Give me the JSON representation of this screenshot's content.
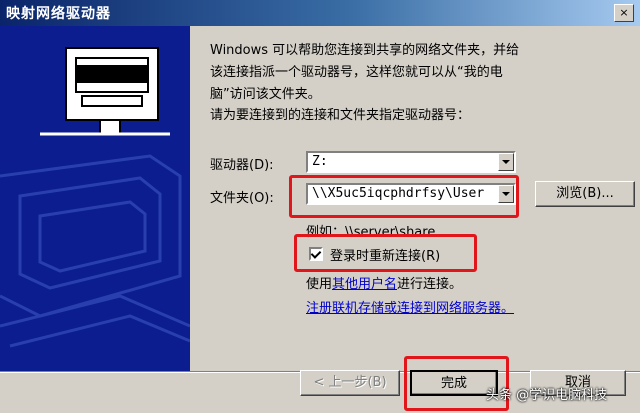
{
  "window": {
    "title": "映射网络驱动器",
    "close_glyph": "×"
  },
  "intro": {
    "line1": "Windows 可以帮助您连接到共享的网络文件夹，并给",
    "line2": "该连接指派一个驱动器号，这样您就可以从“我的电",
    "line3": "脑”访问该文件夹。"
  },
  "prompt": "请为要连接到的连接和文件夹指定驱动器号：",
  "drive": {
    "label": "驱动器(D):",
    "value": "Z:"
  },
  "folder": {
    "label": "文件夹(O):",
    "value": "\\\\X5uc5iqcphdrfsy\\User",
    "browse_label": "浏览(B)..."
  },
  "example": "例如：\\\\server\\share",
  "reconnect": {
    "label": "登录时重新连接(R)",
    "checked": true
  },
  "other_user": {
    "prefix": "使用",
    "link": "其他用户名",
    "suffix": "进行连接。"
  },
  "register_link": "注册联机存储或连接到网络服务器。",
  "buttons": {
    "back": "< 上一步(B)",
    "finish": "完成",
    "cancel": "取消"
  },
  "watermark": "头条 @学识电脑科技",
  "icons": {
    "left_panel": "network-drive-illustration",
    "close": "close-icon",
    "dropdown": "dropdown-arrow-icon",
    "check": "check-icon"
  }
}
